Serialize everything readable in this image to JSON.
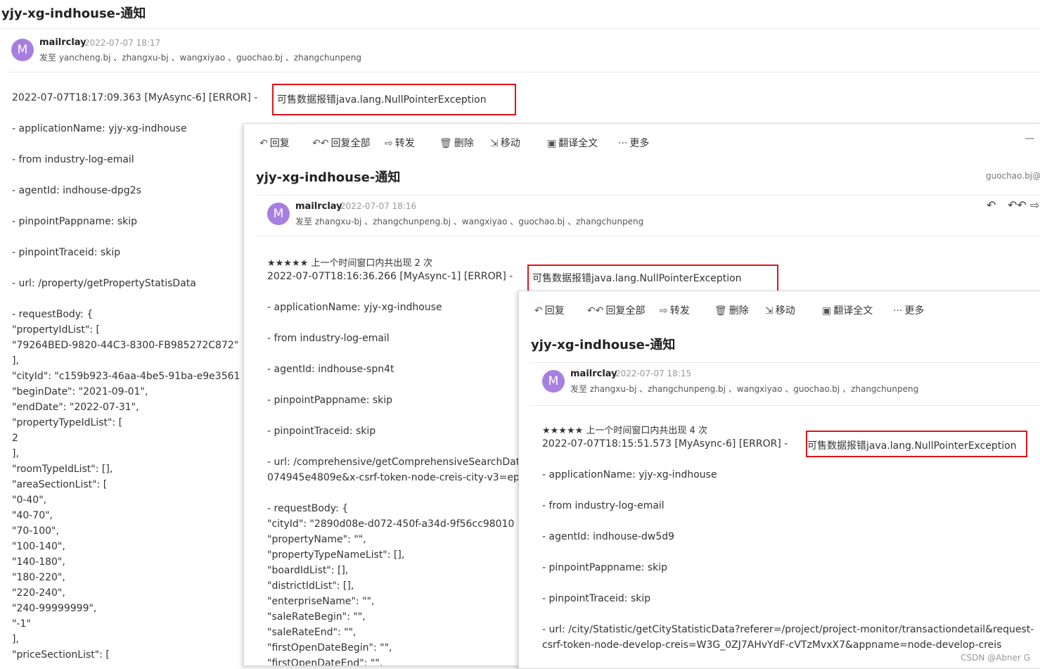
{
  "mail1": {
    "title": "yjy-xg-indhouse-通知",
    "sender": "mailrclay",
    "time": "2022-07-07 18:17",
    "recipients": "发至 yancheng.bj 、zhangxu-bj 、wangxiyao 、guochao.bj 、zhangchunpeng",
    "avatar": "M",
    "error_prefix": "2022-07-07T18:17:09.363 [MyAsync-6]  [ERROR]  -",
    "error_msg": "可售数据报错java.lang.NullPointerException",
    "lines": [
      "- applicationName: yjy-xg-indhouse",
      "- from industry-log-email",
      "- agentId: indhouse-dpg2s",
      "- pinpointPappname: skip",
      "- pinpointTraceid: skip",
      "- url: /property/getPropertyStatisData",
      "-  requestBody: {",
      "\"propertyIdList\": [",
      "\"79264BED-9820-44C3-8300-FB985272C872\"",
      "],",
      "\"cityId\": \"c159b923-46aa-4be5-91ba-e9e3561",
      "\"beginDate\": \"2021-09-01\",",
      "\"endDate\": \"2022-07-31\",",
      "\"propertyTypeIdList\": [",
      "2",
      "],",
      "\"roomTypeIdList\": [],",
      "\"areaSectionList\": [",
      "\"0-40\",",
      "\"40-70\",",
      "\"70-100\",",
      "\"100-140\",",
      "\"140-180\",",
      "\"180-220\",",
      "\"220-240\",",
      "\"240-99999999\",",
      "\"-1\"",
      "],",
      "\"priceSectionList\": ["
    ]
  },
  "mail2": {
    "toolbar": {
      "reply": "回复",
      "reply_all": "回复全部",
      "forward": "转发",
      "delete": "删除",
      "move": "移动",
      "translate": "翻译全文",
      "more": "更多"
    },
    "minimize": "—",
    "title": "yjy-xg-indhouse-通知",
    "right_email": "guochao.bj@",
    "sender": "mailrclay",
    "time": "2022-07-07 18:16",
    "recipients": "发至 zhangxu-bj 、zhangchunpeng.bj 、wangxiyao 、guochao.bj 、zhangchunpeng",
    "avatar": "M",
    "stars_line": "★★★★★ 上一个时间窗口内共出现 2 次",
    "error_prefix": "2022-07-07T18:16:36.266 [MyAsync-1]  [ERROR]  -",
    "error_msg": "可售数据报错java.lang.NullPointerException",
    "lines": [
      "- applicationName: yjy-xg-indhouse",
      "- from industry-log-email",
      "- agentId: indhouse-spn4t",
      "- pinpointPappname: skip",
      "- pinpointTraceid: skip",
      "- url: /comprehensive/getComprehensiveSearchDat",
      "074945e4809e&x-csrf-token-node-creis-city-v3=ep",
      "-  requestBody: {",
      "\"cityId\": \"2890d08e-d072-450f-a34d-9f56cc98010",
      "\"propertyName\": \"\",",
      "\"propertyTypeNameList\": [],",
      "\"boardIdList\": [],",
      "\"districtIdList\": [],",
      "\"enterpriseName\": \"\",",
      "\"saleRateBegin\": \"\",",
      "\"saleRateEnd\": \"\",",
      "\"firstOpenDateBegin\": \"\",",
      "\"firstOpenDateEnd\": \"\","
    ]
  },
  "mail3": {
    "toolbar": {
      "reply": "回复",
      "reply_all": "回复全部",
      "forward": "转发",
      "delete": "删除",
      "move": "移动",
      "translate": "翻译全文",
      "more": "更多"
    },
    "title": "yjy-xg-indhouse-通知",
    "sender": "mailrclay",
    "time": "2022-07-07 18:15",
    "recipients": "发至 zhangxu-bj 、zhangchunpeng.bj 、wangxiyao 、guochao.bj 、zhangchunpeng",
    "avatar": "M",
    "stars_line": "★★★★★ 上一个时间窗口内共出现 4 次",
    "error_prefix": "2022-07-07T18:15:51.573 [MyAsync-6]  [ERROR]  -",
    "error_msg": "可售数据报错java.lang.NullPointerException",
    "lines": [
      "- applicationName: yjy-xg-indhouse",
      "- from industry-log-email",
      "- agentId: indhouse-dw5d9",
      "- pinpointPappname: skip",
      "- pinpointTraceid: skip",
      "- url: /city/Statistic/getCityStatisticData?referer=/project/project-monitor/transactiondetail&request-",
      "csrf-token-node-develop-creis=W3G_0ZJ7AHvYdF-cVTzMvxX7&appname=node-develop-creis"
    ]
  },
  "watermark": "CSDN @Abner G"
}
